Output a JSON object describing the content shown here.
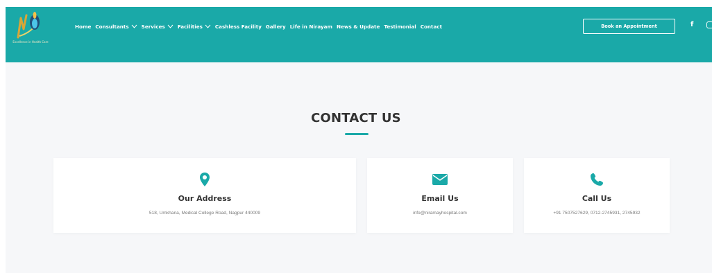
{
  "colors": {
    "brand": "#1aa9a8",
    "heading": "#333333",
    "muted": "#7b7b7b",
    "page_bg": "#f6f7f9"
  },
  "header": {
    "logo_tagline": "Excellence in Health Care",
    "nav": [
      {
        "label": "Home",
        "dropdown": false
      },
      {
        "label": "Consultants",
        "dropdown": true
      },
      {
        "label": "Services",
        "dropdown": true
      },
      {
        "label": "Facilities",
        "dropdown": true
      },
      {
        "label": "Cashless Facility",
        "dropdown": false
      },
      {
        "label": "Gallery",
        "dropdown": false
      },
      {
        "label": "Life in Nirayam",
        "dropdown": false
      },
      {
        "label": "News & Update",
        "dropdown": false
      },
      {
        "label": "Testimonial",
        "dropdown": false
      },
      {
        "label": "Contact",
        "dropdown": false
      }
    ],
    "cta_label": "Book an Appointment",
    "social": {
      "facebook": "f",
      "icons": [
        "facebook-icon",
        "instagram-icon"
      ]
    }
  },
  "contact": {
    "title": "CONTACT US",
    "cards": [
      {
        "icon": "location-pin-icon",
        "title": "Our Address",
        "value": "518, Umkhana, Medical College Road, Nagpur 440009"
      },
      {
        "icon": "envelope-icon",
        "title": "Email Us",
        "value": "info@niramayhospital.com"
      },
      {
        "icon": "phone-icon",
        "title": "Call Us",
        "value": "+91 7507527629, 0712-2745931, 2745932"
      }
    ]
  }
}
